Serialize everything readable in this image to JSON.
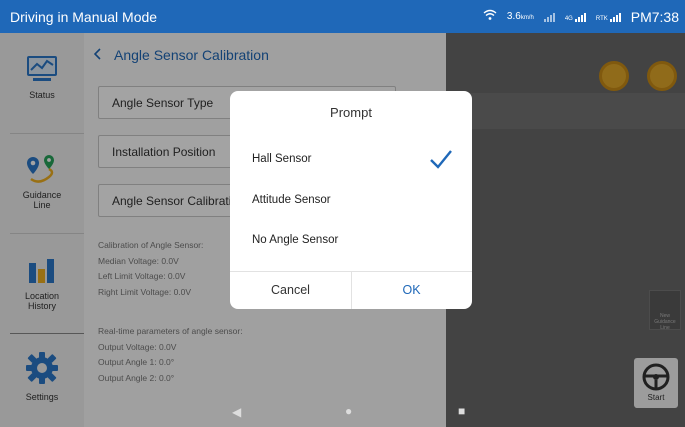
{
  "statusbar": {
    "mode": "Driving in Manual Mode",
    "speed": "3.6",
    "speed_unit": "km/h",
    "net_label": "4G",
    "rtk_label": "RTK",
    "time": "PM7:38"
  },
  "sidebar": {
    "items": [
      {
        "label": "Status",
        "icon": "chart-monitor-icon"
      },
      {
        "label": "Guidance\nLine",
        "icon": "route-pin-icon"
      },
      {
        "label": "Location\nHistory",
        "icon": "bar-chart-icon"
      },
      {
        "label": "Settings",
        "icon": "gear-icon"
      }
    ]
  },
  "page": {
    "back_title": "Angle Sensor Calibration",
    "fields": [
      {
        "label": "Angle Sensor Type"
      },
      {
        "label": "Installation Position"
      },
      {
        "label": "Angle Sensor Calibration"
      }
    ],
    "calibration": {
      "heading": "Calibration of Angle Sensor:",
      "median": "Median Voltage: 0.0V",
      "left": "Left Limit Voltage: 0.0V",
      "right": "Right Limit Voltage: 0.0V"
    },
    "realtime": {
      "heading": "Real-time parameters of angle sensor:",
      "output_voltage": "Output Voltage: 0.0V",
      "angle1": "Output Angle 1: 0.0°",
      "angle2": "Output Angle 2: 0.0°"
    }
  },
  "map": {
    "new_guidance": "New Guidance Line",
    "start": "Start"
  },
  "dialog": {
    "title": "Prompt",
    "options": [
      "Hall Sensor",
      "Attitude Sensor",
      "No Angle Sensor"
    ],
    "selected": "Hall Sensor",
    "cancel": "Cancel",
    "ok": "OK"
  },
  "colors": {
    "brand": "#1f68b8",
    "accent": "#1f68b8",
    "map_button": "#e2a82a"
  }
}
